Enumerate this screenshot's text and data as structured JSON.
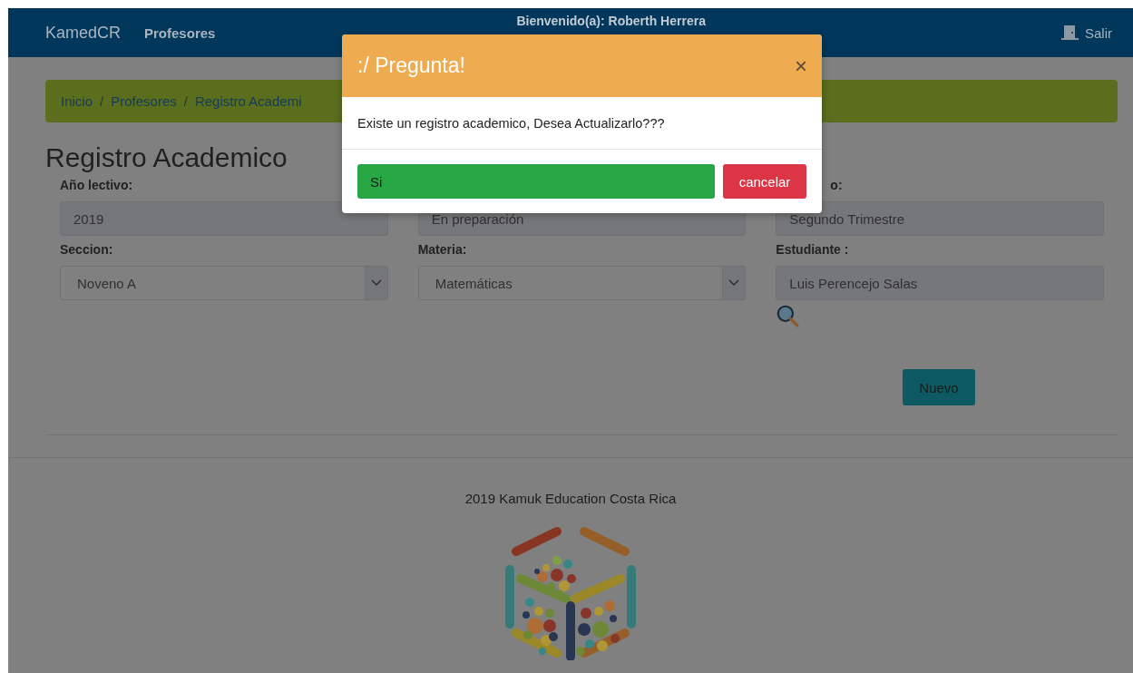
{
  "navbar": {
    "brand": "KamedCR",
    "links": [
      {
        "label": "Profesores"
      }
    ],
    "welcome": "Bienvenido(a): Roberth Herrera",
    "logout": "Salir"
  },
  "breadcrumb": [
    "Inicio",
    "Profesores",
    "Registro Academi"
  ],
  "breadcrumb_separator": "/",
  "heading": "Registro Academico",
  "fields": [
    {
      "kind": "text",
      "label": "Año lectivo:",
      "value": "2019"
    },
    {
      "kind": "text",
      "value": "En preparación"
    },
    {
      "kind": "text",
      "label": "o:",
      "value": "Segundo Trimestre"
    },
    {
      "kind": "select",
      "label": "Seccion:",
      "value": "Noveno A"
    },
    {
      "kind": "select",
      "label": "Materia:",
      "value": "Matemáticas"
    },
    {
      "kind": "search",
      "label": "Estudiante :",
      "value": "Luis Perencejo Salas"
    }
  ],
  "new_button": "Nuevo",
  "footer": "2019 Kamuk Education Costa Rica",
  "dialog": {
    "title": ":/ Pregunta!",
    "close": "×",
    "message": "Existe un registro academico, Desea Actualizarlo???",
    "confirm": "Si",
    "cancel": "cancelar"
  }
}
